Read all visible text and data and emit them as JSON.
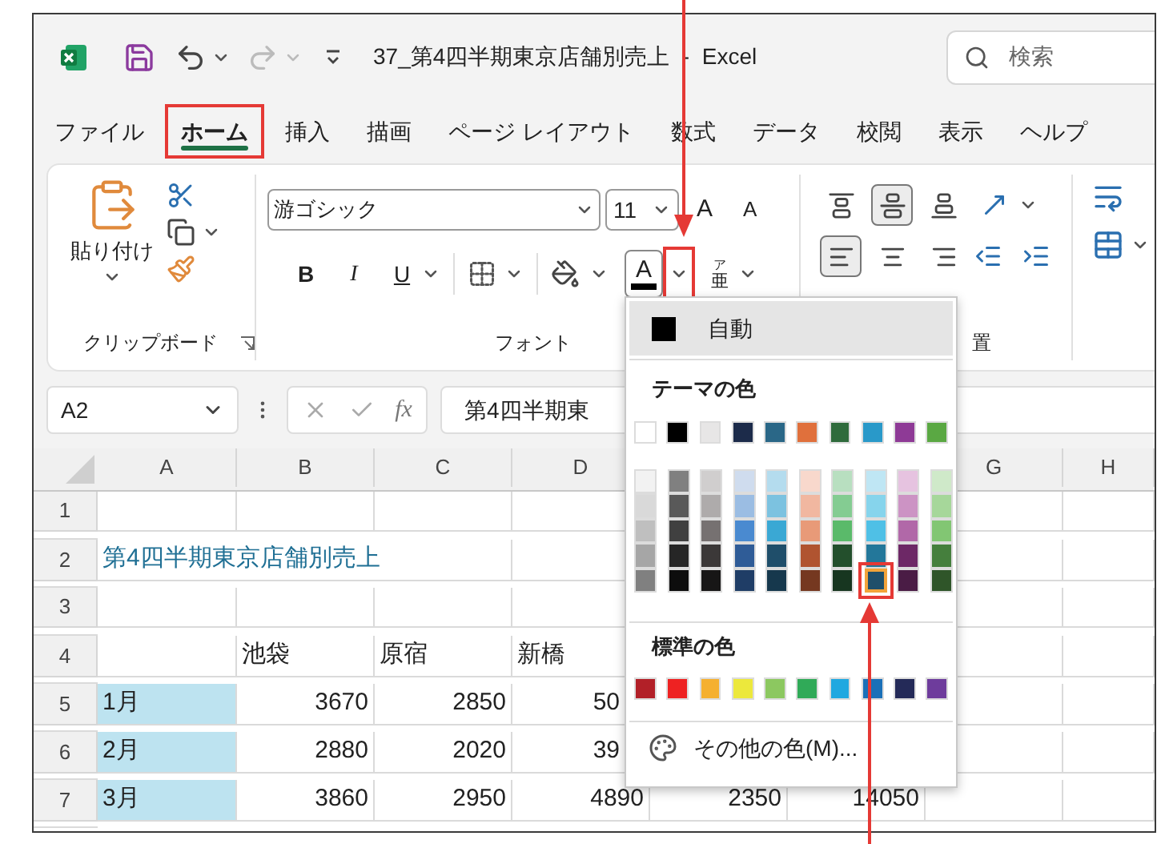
{
  "title_bar": {
    "title": "37_第4四半期東京店舗別売上  -  Excel",
    "search": {
      "placeholder": "検索"
    }
  },
  "tabs": [
    {
      "label": "ファイル",
      "selected": false,
      "highlighted": false
    },
    {
      "label": "ホーム",
      "selected": true,
      "highlighted": true
    },
    {
      "label": "挿入",
      "selected": false,
      "highlighted": false
    },
    {
      "label": "描画",
      "selected": false,
      "highlighted": false
    },
    {
      "label": "ページ レイアウト",
      "selected": false,
      "highlighted": false
    },
    {
      "label": "数式",
      "selected": false,
      "highlighted": false
    },
    {
      "label": "データ",
      "selected": false,
      "highlighted": false
    },
    {
      "label": "校閲",
      "selected": false,
      "highlighted": false
    },
    {
      "label": "表示",
      "selected": false,
      "highlighted": false
    },
    {
      "label": "ヘルプ",
      "selected": false,
      "highlighted": false
    }
  ],
  "ribbon": {
    "clipboard": {
      "paste_label": "貼り付け",
      "group_label": "クリップボード"
    },
    "font": {
      "font_name": "游ゴシック",
      "font_size": "11",
      "grow": "A",
      "shrink": "A",
      "bold": "B",
      "italic": "I",
      "underline": "U",
      "font_color": "A",
      "font_color_dropdown_highlighted": true,
      "phonetic_top": "ア",
      "phonetic_bottom": "亜",
      "group_label": "フォント"
    },
    "alignment": {
      "vertical": [
        {
          "kind": "top",
          "selected": false
        },
        {
          "kind": "middle",
          "selected": true
        },
        {
          "kind": "bottom",
          "selected": false
        }
      ],
      "horizontal": [
        {
          "kind": "left",
          "selected": true
        },
        {
          "kind": "center",
          "selected": false
        },
        {
          "kind": "right",
          "selected": false
        }
      ],
      "group_label": "置"
    }
  },
  "formula_bar": {
    "name_box": "A2",
    "fx": "fx",
    "formula": "第4四半期東"
  },
  "sheet": {
    "columns": [
      "A",
      "B",
      "C",
      "D",
      null,
      null,
      "G",
      "H"
    ],
    "rows": [
      {
        "number": "1",
        "kind": "blank",
        "cells": []
      },
      {
        "number": "2",
        "kind": "title",
        "cells": [
          "第4四半期東京店舗別売上"
        ]
      },
      {
        "number": "3",
        "kind": "blank",
        "cells": []
      },
      {
        "number": "4",
        "kind": "header",
        "cells": [
          null,
          "池袋",
          "原宿",
          "新橋"
        ]
      },
      {
        "number": "5",
        "kind": "data",
        "label_filled": true,
        "cells": [
          "1月",
          "3670",
          "2850",
          {
            "text": "50",
            "cut": true
          }
        ]
      },
      {
        "number": "6",
        "kind": "data",
        "label_filled": true,
        "cells": [
          "2月",
          "2880",
          "2020",
          {
            "text": "39",
            "cut": true
          }
        ]
      },
      {
        "number": "7",
        "kind": "data",
        "label_filled": true,
        "cells": [
          "3月",
          "3860",
          "2950",
          "4890",
          "2350",
          "14050"
        ]
      }
    ]
  },
  "font_color_menu": {
    "automatic": {
      "label": "自動",
      "color": "#000000"
    },
    "theme_label": "テーマの色",
    "theme_colors": [
      {
        "color": "#ffffff",
        "selected": false,
        "shades": [
          {
            "color": "#f2f2f2",
            "selected": false
          },
          {
            "color": "#d9d9d9",
            "selected": false
          },
          {
            "color": "#bfbfbf",
            "selected": false
          },
          {
            "color": "#a6a6a6",
            "selected": false
          },
          {
            "color": "#808080",
            "selected": false
          }
        ]
      },
      {
        "color": "#000000",
        "selected": false,
        "shades": [
          {
            "color": "#808080",
            "selected": false
          },
          {
            "color": "#595959",
            "selected": false
          },
          {
            "color": "#404040",
            "selected": false
          },
          {
            "color": "#262626",
            "selected": false
          },
          {
            "color": "#0d0d0d",
            "selected": false
          }
        ]
      },
      {
        "color": "#e7e6e6",
        "selected": false,
        "shades": [
          {
            "color": "#d0cece",
            "selected": false
          },
          {
            "color": "#aeabab",
            "selected": false
          },
          {
            "color": "#767171",
            "selected": false
          },
          {
            "color": "#3b3838",
            "selected": false
          },
          {
            "color": "#171616",
            "selected": false
          }
        ]
      },
      {
        "color": "#1c2b4a",
        "selected": false,
        "shades": [
          {
            "color": "#cfdcee",
            "selected": false
          },
          {
            "color": "#9bbde3",
            "selected": false
          },
          {
            "color": "#4a8ad0",
            "selected": false
          },
          {
            "color": "#2f5c97",
            "selected": false
          },
          {
            "color": "#1f3d66",
            "selected": false
          }
        ]
      },
      {
        "color": "#2a6787",
        "selected": false,
        "shades": [
          {
            "color": "#b4dcee",
            "selected": false
          },
          {
            "color": "#7cc2e0",
            "selected": false
          },
          {
            "color": "#3aa8d4",
            "selected": false
          },
          {
            "color": "#1f4e6a",
            "selected": false
          },
          {
            "color": "#16384d",
            "selected": false
          }
        ]
      },
      {
        "color": "#e0703c",
        "selected": false,
        "shades": [
          {
            "color": "#f8d8cc",
            "selected": false
          },
          {
            "color": "#f1b7a0",
            "selected": false
          },
          {
            "color": "#e89a78",
            "selected": false
          },
          {
            "color": "#b05430",
            "selected": false
          },
          {
            "color": "#753820",
            "selected": false
          }
        ]
      },
      {
        "color": "#2f6b3c",
        "selected": false,
        "shades": [
          {
            "color": "#b8dfc0",
            "selected": false
          },
          {
            "color": "#84cc92",
            "selected": false
          },
          {
            "color": "#5aba6a",
            "selected": false
          },
          {
            "color": "#234f2c",
            "selected": false
          },
          {
            "color": "#173620",
            "selected": false
          }
        ]
      },
      {
        "color": "#2999c9",
        "selected": false,
        "shades": [
          {
            "color": "#bfe6f4",
            "selected": false
          },
          {
            "color": "#86d4ec",
            "selected": false
          },
          {
            "color": "#4fc0e6",
            "selected": false
          },
          {
            "color": "#23779a",
            "selected": false
          },
          {
            "color": "#1f4f6a",
            "selected": true
          }
        ]
      },
      {
        "color": "#8e3a96",
        "selected": false,
        "shades": [
          {
            "color": "#e6c3e0",
            "selected": false
          },
          {
            "color": "#cc93c4",
            "selected": false
          },
          {
            "color": "#b168a8",
            "selected": false
          },
          {
            "color": "#6d2866",
            "selected": false
          },
          {
            "color": "#4a1c45",
            "selected": false
          }
        ]
      },
      {
        "color": "#5aa843",
        "selected": false,
        "shades": [
          {
            "color": "#cfe9c9",
            "selected": false
          },
          {
            "color": "#a6d79a",
            "selected": false
          },
          {
            "color": "#82c673",
            "selected": false
          },
          {
            "color": "#457f3d",
            "selected": false
          },
          {
            "color": "#2f5529",
            "selected": false
          }
        ]
      }
    ],
    "standard_label": "標準の色",
    "standard_colors": [
      {
        "color": "#b22028",
        "selected": false
      },
      {
        "color": "#ee2222",
        "selected": false
      },
      {
        "color": "#f5b030",
        "selected": false
      },
      {
        "color": "#ece83c",
        "selected": false
      },
      {
        "color": "#8cc860",
        "selected": false
      },
      {
        "color": "#30aa58",
        "selected": false
      },
      {
        "color": "#20a8e0",
        "selected": false
      },
      {
        "color": "#1a70b8",
        "selected": false
      },
      {
        "color": "#242a58",
        "selected": false
      },
      {
        "color": "#6e3c9c",
        "selected": false
      }
    ],
    "more_colors": "その他の色(M)..."
  }
}
